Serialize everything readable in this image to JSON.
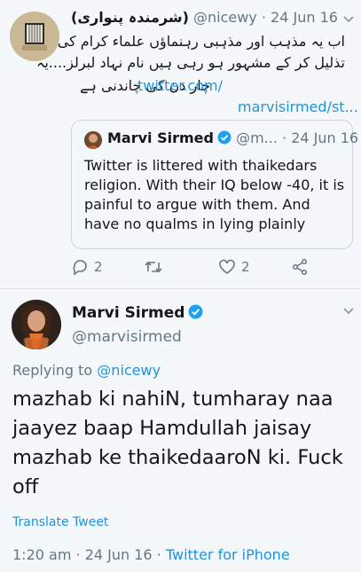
{
  "quoting_tweet": {
    "author_name": "(شرمندہ پنواری)",
    "author_handle": "@nicewy",
    "separator": "·",
    "date": "24 Jun 16",
    "text_lines": [
      "اب یہ مذہب اور مذہبی رہنماؤں علماء کرام کی",
      "تذلیل کر کے مشہور ہو رہی ہیں نام نہاد لبرلز....یہ",
      "چار دن کی چاندنی ہے",
      "marvisirmed/st..."
    ],
    "link_text": "twitter.com/",
    "actions": {
      "reply_count": "2",
      "like_count": "2"
    }
  },
  "quoted_tweet": {
    "author_name": "Marvi Sirmed",
    "author_handle": "@m...",
    "separator": "·",
    "date": "24 Jun 16",
    "text": "Twitter is littered with thaikedars religion. With their IQ below -40, it is painful to argue with them. And have no qualms in lying plainly"
  },
  "main_tweet": {
    "author_name": "Marvi Sirmed",
    "author_handle": "@marvisirmed",
    "replying_prefix": "Replying to",
    "replying_handle": "@nicewy",
    "text": "mazhab ki nahiN, tumharay naa jaayez baap Hamdullah jaisay mazhab ke thaikedaaroN ki. Fuck off",
    "translate_label": "Translate Tweet",
    "time": "1:20 am",
    "separator": "·",
    "date": "24 Jun 16",
    "separator2": "·",
    "source": "Twitter for iPhone"
  },
  "icons": {
    "reply": "reply-icon",
    "retweet": "retweet-icon",
    "like": "heart-icon",
    "share": "share-icon",
    "verified": "verified-badge-icon",
    "more": "chevron-down-icon"
  },
  "colors": {
    "accent": "#1b95e0",
    "muted": "#657786",
    "background": "#f5f8fa"
  }
}
